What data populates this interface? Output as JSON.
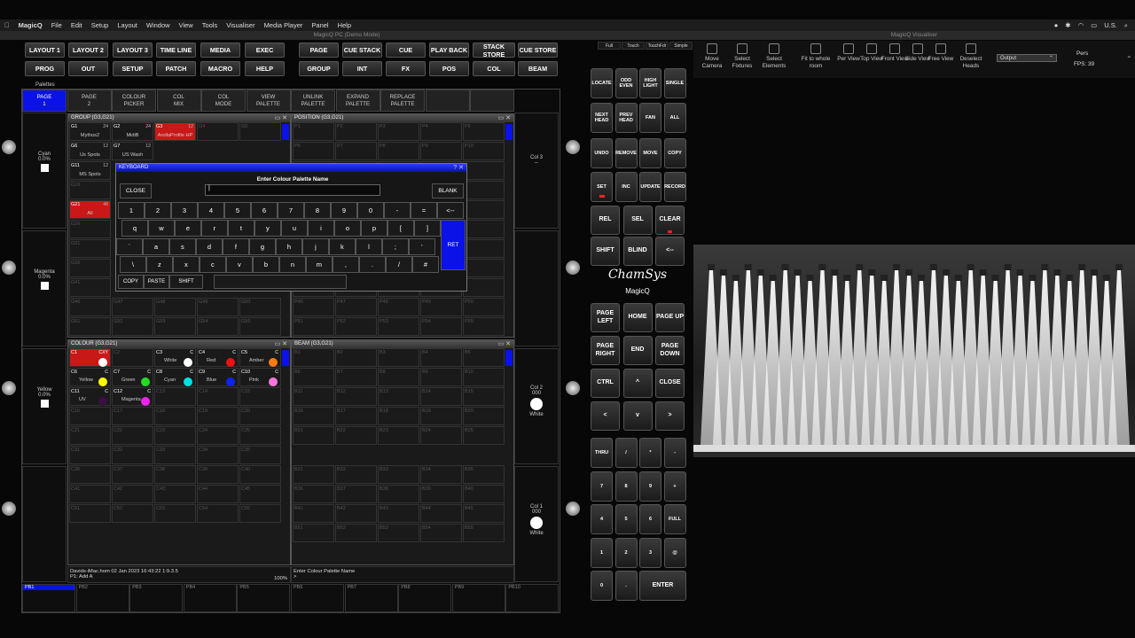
{
  "menubar": {
    "apple": "",
    "app": "MagicQ",
    "items": [
      "File",
      "Edit",
      "Setup",
      "Layout",
      "Window",
      "View",
      "Tools",
      "Visualiser",
      "Media Player",
      "Panel",
      "Help"
    ],
    "status": "U.S."
  },
  "window_title": "MagicQ PC (Demo Mode)",
  "visualiser_title": "MagicQ Visualiser",
  "top_buttons_row1": [
    "LAYOUT 1",
    "LAYOUT 2",
    "LAYOUT 3",
    "TIME LINE",
    "MEDIA",
    "EXEC",
    "PAGE",
    "CUE STACK",
    "CUE",
    "PLAY BACK",
    "STACK STORE",
    "CUE STORE"
  ],
  "top_buttons_row2": [
    "PROG",
    "OUT",
    "SETUP",
    "PATCH",
    "MACRO",
    "HELP",
    "GROUP",
    "INT",
    "FX",
    "POS",
    "COL",
    "BEAM"
  ],
  "palettes_tab": "Palettes",
  "softkeys": [
    "PAGE\n1",
    "PAGE\n2",
    "COLOUR\nPICKER",
    "COL\nMIX",
    "COL\nMODE",
    "VIEW\nPALETTE",
    "UNLINK\nPALETTE",
    "EXPAND\nPALETTE",
    "REPLACE\nPALETTE",
    "",
    ""
  ],
  "left_encoders": [
    {
      "name": "Cyan",
      "value": "0.0%"
    },
    {
      "name": "Magenta",
      "value": "0.0%"
    },
    {
      "name": "Yellow",
      "value": "0.0%"
    }
  ],
  "right_encoders": [
    {
      "name": "Col 3",
      "value": "--"
    },
    {
      "name": "Col 2",
      "value": "000",
      "sub": "White"
    },
    {
      "name": "Col 1",
      "value": "000",
      "sub": "White"
    }
  ],
  "group_window": {
    "title": "GROUP (G3,G21)",
    "cells": [
      {
        "id": "G1",
        "num": "24",
        "name": "Mythos2"
      },
      {
        "id": "G2",
        "num": "24",
        "name": "MidiB"
      },
      {
        "id": "G3",
        "num": "12",
        "name": "ArollaProfile HP",
        "active": true
      },
      {
        "id": "G4"
      },
      {
        "id": "G5"
      },
      {
        "id": "G6",
        "num": "12",
        "name": "Us Spots"
      },
      {
        "id": "G7",
        "num": "12",
        "name": "US Wash"
      },
      {
        "id": "G11",
        "num": "12",
        "name": "MS Spots"
      },
      {
        "id": "G16"
      },
      {
        "id": "G21",
        "num": "48",
        "name": "All",
        "active": true
      },
      {
        "id": "G26"
      },
      {
        "id": "G31"
      },
      {
        "id": "G36"
      },
      {
        "id": "G41"
      },
      {
        "id": "G46"
      },
      {
        "id": "G47"
      },
      {
        "id": "G48"
      },
      {
        "id": "G49"
      },
      {
        "id": "G50"
      },
      {
        "id": "G51"
      },
      {
        "id": "G52"
      },
      {
        "id": "G53"
      },
      {
        "id": "G54"
      },
      {
        "id": "G55"
      }
    ]
  },
  "position_window": {
    "title": "POSITION (G3,G21)",
    "cells": [
      "P1",
      "P2",
      "P3",
      "P4",
      "P5",
      "P6",
      "P7",
      "P8",
      "P9",
      "P10",
      "P46",
      "P47",
      "P48",
      "P49",
      "P50",
      "P51",
      "P52",
      "P53",
      "P54",
      "P55"
    ]
  },
  "colour_window": {
    "title": "COLOUR (G3,G21)",
    "cells": [
      {
        "id": "C1",
        "num": "CXY",
        "name": "",
        "active": true,
        "color": "#ffffff"
      },
      {
        "id": "C2"
      },
      {
        "id": "C3",
        "num": "C",
        "name": "White",
        "color": "#ffffff"
      },
      {
        "id": "C4",
        "num": "C",
        "name": "Red",
        "color": "#ee1111"
      },
      {
        "id": "C5",
        "num": "C",
        "name": "Amber",
        "color": "#ff7a1a"
      },
      {
        "id": "C6",
        "num": "C",
        "name": "Yellow",
        "color": "#ffff00"
      },
      {
        "id": "C7",
        "num": "C",
        "name": "Green",
        "color": "#22dd22"
      },
      {
        "id": "C8",
        "num": "C",
        "name": "Cyan",
        "color": "#00e0e0"
      },
      {
        "id": "C9",
        "num": "C",
        "name": "Blue",
        "color": "#1122ee"
      },
      {
        "id": "C10",
        "num": "C",
        "name": "Pink",
        "color": "#ff77dd"
      },
      {
        "id": "C11",
        "num": "C",
        "name": "UV",
        "color": "#3a1040"
      },
      {
        "id": "C12",
        "num": "C",
        "name": "Magenta",
        "color": "#ee22ee"
      },
      {
        "id": "C13"
      },
      {
        "id": "C14"
      },
      {
        "id": "C15"
      },
      {
        "id": "C16"
      },
      {
        "id": "C17"
      },
      {
        "id": "C18"
      },
      {
        "id": "C19"
      },
      {
        "id": "C20"
      },
      {
        "id": "C21"
      },
      {
        "id": "C22"
      },
      {
        "id": "C23"
      },
      {
        "id": "C24"
      },
      {
        "id": "C25"
      },
      {
        "id": "C31"
      },
      {
        "id": "C32"
      },
      {
        "id": "C33"
      },
      {
        "id": "C34"
      },
      {
        "id": "C35"
      },
      {
        "id": "C36"
      },
      {
        "id": "C37"
      },
      {
        "id": "C38"
      },
      {
        "id": "C39"
      },
      {
        "id": "C40"
      },
      {
        "id": "C41"
      },
      {
        "id": "C42"
      },
      {
        "id": "C43"
      },
      {
        "id": "C44"
      },
      {
        "id": "C45"
      },
      {
        "id": "C51"
      },
      {
        "id": "C52"
      },
      {
        "id": "C53"
      },
      {
        "id": "C54"
      },
      {
        "id": "C55"
      }
    ]
  },
  "beam_window": {
    "title": "BEAM (G3,G21)",
    "cells": [
      "B1",
      "B2",
      "B3",
      "B4",
      "B5",
      "B6",
      "B7",
      "B8",
      "B9",
      "B10",
      "B11",
      "B12",
      "B13",
      "B14",
      "B15",
      "B16",
      "B17",
      "B18",
      "B19",
      "B20",
      "B21",
      "B22",
      "B23",
      "B24",
      "B25",
      "B31",
      "B32",
      "B33",
      "B34",
      "B35",
      "B36",
      "B37",
      "B38",
      "B39",
      "B40",
      "B41",
      "B42",
      "B43",
      "B44",
      "B45",
      "B51",
      "B52",
      "B53",
      "B54",
      "B55"
    ]
  },
  "keyboard": {
    "title": "KEYBOARD",
    "prompt": "Enter Colour Palette Name",
    "close": "CLOSE",
    "blank": "BLANK",
    "input_value": "|",
    "rows": [
      [
        "1",
        "2",
        "3",
        "4",
        "5",
        "6",
        "7",
        "8",
        "9",
        "0",
        "-",
        "=",
        "<--"
      ],
      [
        "q",
        "w",
        "e",
        "r",
        "t",
        "y",
        "u",
        "i",
        "o",
        "p",
        "[",
        "]"
      ],
      [
        "`",
        "a",
        "s",
        "d",
        "f",
        "g",
        "h",
        "j",
        "k",
        "l",
        ";",
        "'"
      ],
      [
        "\\",
        "z",
        "x",
        "c",
        "v",
        "b",
        "n",
        "m",
        ",",
        ".",
        "/",
        "#"
      ]
    ],
    "ret": "RET",
    "copy": "COPY",
    "paste": "PASTE",
    "shift": "SHIFT"
  },
  "status": {
    "left_line1": "Davids-iMac.hom 02 Jan 2023 16:43:22 1:9.3.5",
    "left_line2": "P1: Add A",
    "zoom": "100%",
    "right_line1": "Enter Colour Palette Name",
    "right_line2": ">"
  },
  "playbacks": [
    "PB1",
    "PB2",
    "PB3",
    "PB4",
    "PB5",
    "PB6",
    "PB7",
    "PB8",
    "PB9",
    "PB10"
  ],
  "panel": {
    "modes": [
      "Full",
      "Touch",
      "TouchFdr",
      "Simple"
    ],
    "row1": [
      "LOCATE",
      "ODD EVEN",
      "HIGH LIGHT",
      "SINGLE"
    ],
    "row2": [
      "NEXT HEAD",
      "PREV HEAD",
      "FAN",
      "ALL"
    ],
    "row3": [
      "UNDO",
      "REMOVE",
      "MOVE",
      "COPY"
    ],
    "row4": [
      "SET",
      "INC",
      "UPDATE",
      "RECORD"
    ],
    "row5": [
      "REL",
      "SEL",
      "CLEAR"
    ],
    "row6": [
      "SHIFT",
      "BLIND",
      "<--"
    ],
    "logo": "ChamSys",
    "logo_sub": "MagicQ",
    "nav1": [
      "PAGE LEFT",
      "HOME",
      "PAGE UP"
    ],
    "nav2": [
      "PAGE RIGHT",
      "END",
      "PAGE DOWN"
    ],
    "nav3": [
      "CTRL",
      "^",
      "CLOSE"
    ],
    "nav4": [
      "<",
      "v",
      ">"
    ],
    "keypad": [
      [
        "THRU",
        "/",
        "*",
        "-"
      ],
      [
        "7",
        "8",
        "9",
        "+"
      ],
      [
        "4",
        "5",
        "6",
        "FULL"
      ],
      [
        "1",
        "2",
        "3",
        "@"
      ],
      [
        "0",
        ".",
        "ENTER"
      ]
    ]
  },
  "visualiser": {
    "tools": [
      "Move Camera",
      "Select Fixtures",
      "Select Elements",
      "Fit to whole room",
      "Per View",
      "Top View",
      "Front View",
      "Side View",
      "Free View",
      "Deselect Heads"
    ],
    "output": "Output",
    "view": "Pers",
    "fps": "FPS: 39"
  }
}
